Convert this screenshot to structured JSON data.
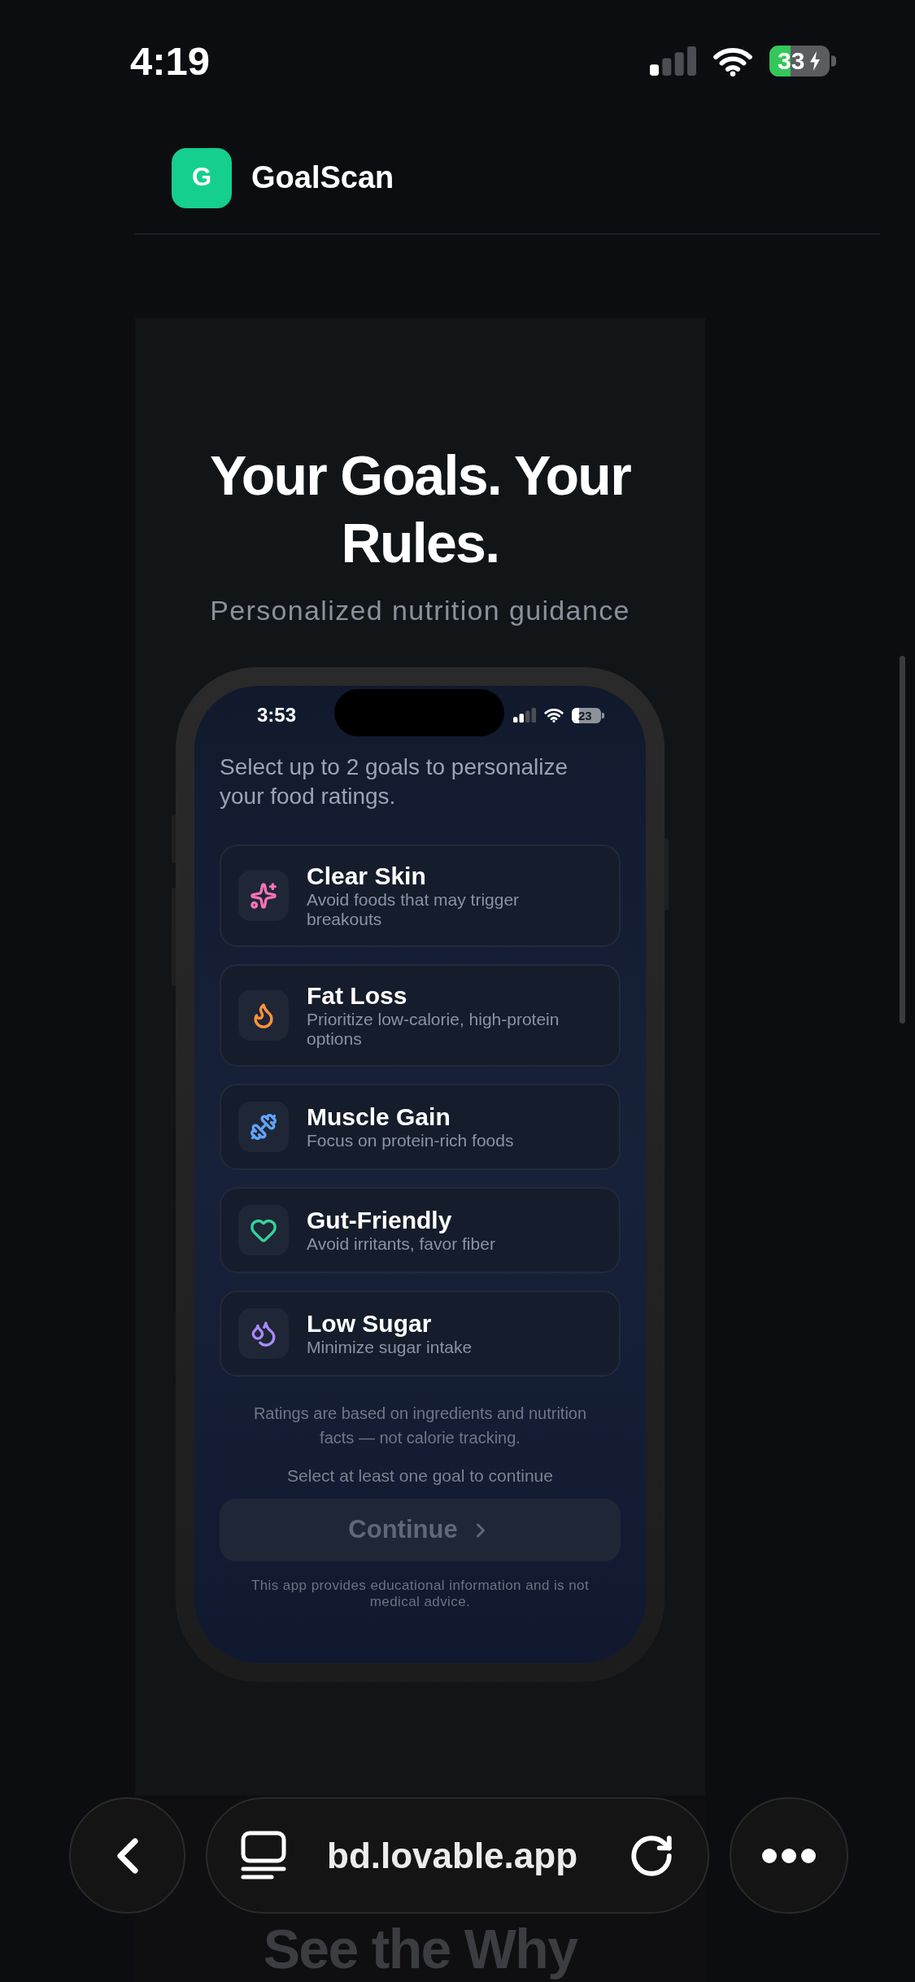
{
  "status_bar": {
    "time": "4:19",
    "battery": "33"
  },
  "header": {
    "logo_letter": "G",
    "app_name": "GoalScan"
  },
  "hero": {
    "title": "Your Goals. Your Rules.",
    "subtitle": "Personalized nutrition guidance"
  },
  "phone": {
    "status_bar": {
      "time": "3:53",
      "battery": "23"
    },
    "prompt": "Select up to 2 goals to personalize your food ratings.",
    "goals": [
      {
        "title": "Clear Skin",
        "description": "Avoid foods that may trigger breakouts",
        "color": "#f472b6",
        "selected": false
      },
      {
        "title": "Fat Loss",
        "description": "Prioritize low-calorie, high-protein options",
        "color": "#fb923c",
        "selected": false
      },
      {
        "title": "Muscle Gain",
        "description": "Focus on protein-rich foods",
        "color": "#60a5fa",
        "selected": false
      },
      {
        "title": "Gut-Friendly",
        "description": "Avoid irritants, favor fiber",
        "color": "#34d399",
        "selected": false
      },
      {
        "title": "Low Sugar",
        "description": "Minimize sugar intake",
        "color": "#a78bfa",
        "selected": false
      }
    ],
    "note": "Ratings are based on ingredients and nutrition facts — not calorie tracking.",
    "hint": "Select at least one goal to continue",
    "continue_button": {
      "label": "Continue",
      "disabled": true
    },
    "disclaimer": "This app provides educational information and is not medical advice."
  },
  "next_section": {
    "title": "See the Why"
  },
  "browser_bar": {
    "url": "bd.lovable.app"
  }
}
